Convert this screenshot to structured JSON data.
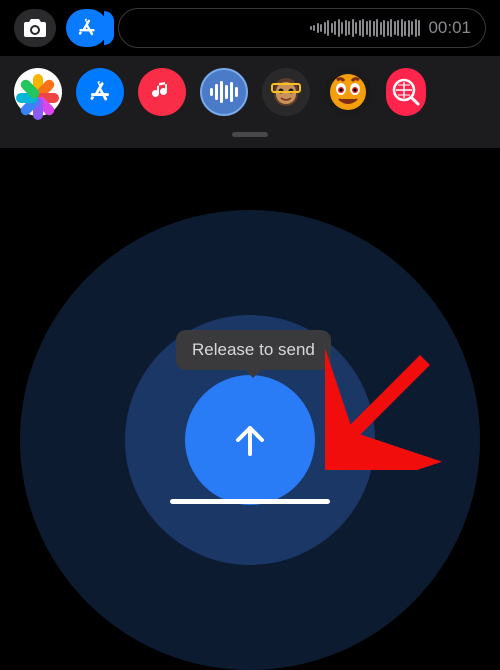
{
  "topbar": {
    "timer": "00:01"
  },
  "tooltip": {
    "text": "Release to send"
  },
  "apps": {
    "photos": "Photos",
    "store": "App Store",
    "music": "Apple Music",
    "audio": "Audio Messages",
    "memoji1": "Memoji",
    "memoji2": "Animoji",
    "search": "#images"
  },
  "colors": {
    "accent": "#2a7bf6",
    "ring_mid": "#1a3766",
    "ring_outer": "#0d1b30",
    "tooltip_bg": "#3a3a3c",
    "annotation_arrow": "#f20d0d"
  }
}
